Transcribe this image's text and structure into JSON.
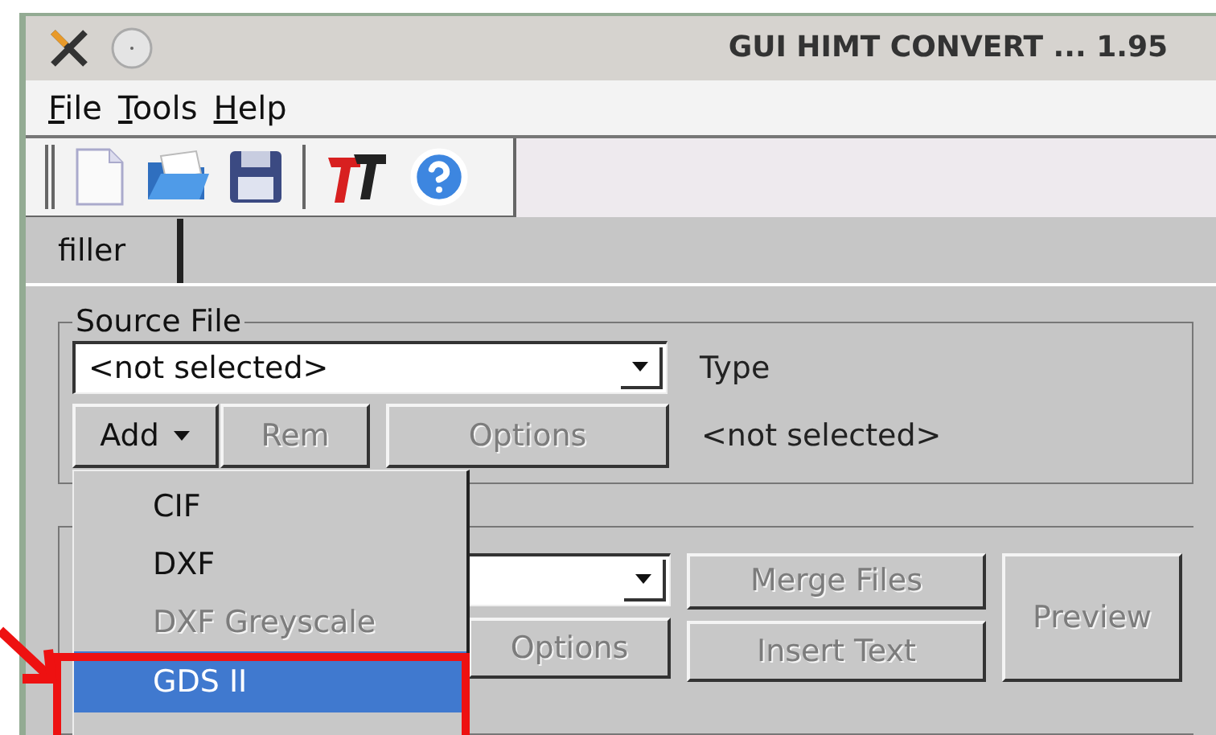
{
  "window": {
    "title": "GUI HIMT CONVERT  ... 1.95"
  },
  "menu": [
    "File",
    "Tools",
    "Help"
  ],
  "tabs": [
    {
      "label": "filler",
      "selected": true
    }
  ],
  "source_file": {
    "title": "Source File",
    "file_combo": {
      "value": "<not selected>"
    },
    "type_label": "Type",
    "type_value": "<not selected>",
    "buttons": [
      {
        "label": "Add",
        "disabled": false,
        "kind": "menu"
      },
      {
        "label": "Rem",
        "disabled": true,
        "kind": "plain"
      },
      {
        "label": "Options",
        "disabled": true,
        "kind": "plain"
      }
    ]
  },
  "output": {
    "buttons": [
      {
        "label": "Options",
        "disabled": true
      },
      {
        "label": "Merge Files",
        "disabled": true
      },
      {
        "label": "Insert Text",
        "disabled": true
      },
      {
        "label": "Preview",
        "disabled": true
      }
    ]
  },
  "dropdown_menu": {
    "items": [
      {
        "label": "CIF",
        "disabled": false,
        "selected": false
      },
      {
        "label": "DXF",
        "disabled": false,
        "selected": false
      },
      {
        "label": "DXF Greyscale",
        "disabled": true,
        "selected": false
      },
      {
        "label": "GDS II",
        "disabled": false,
        "selected": true
      }
    ]
  }
}
